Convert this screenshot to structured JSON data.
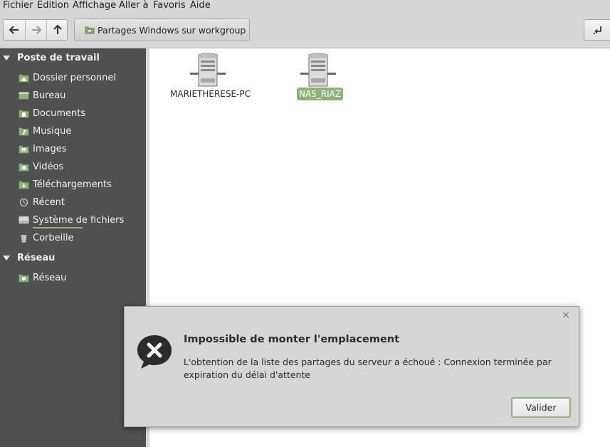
{
  "menubar": {
    "items": [
      "Fichier",
      "Édition",
      "Affichage",
      "Aller à",
      "Favoris",
      "Aide"
    ]
  },
  "toolbar": {
    "back_icon": "arrow-left-icon",
    "forward_icon": "arrow-right-icon",
    "up_icon": "arrow-up-icon",
    "location_label": "Partages Windows sur workgroup",
    "location_icon": "network-folder-icon",
    "toggle_icon": "location-entry-toggle-icon"
  },
  "sidebar": {
    "sections": [
      {
        "title": "Poste de travail",
        "items": [
          {
            "label": "Dossier personnel",
            "icon": "home-folder-icon"
          },
          {
            "label": "Bureau",
            "icon": "desktop-icon"
          },
          {
            "label": "Documents",
            "icon": "documents-folder-icon"
          },
          {
            "label": "Musique",
            "icon": "music-folder-icon"
          },
          {
            "label": "Images",
            "icon": "pictures-folder-icon"
          },
          {
            "label": "Vidéos",
            "icon": "videos-folder-icon"
          },
          {
            "label": "Téléchargements",
            "icon": "downloads-folder-icon"
          },
          {
            "label": "Récent",
            "icon": "recent-icon"
          },
          {
            "label": "Système de fichiers",
            "icon": "drive-icon"
          },
          {
            "label": "Corbeille",
            "icon": "trash-icon"
          }
        ]
      },
      {
        "title": "Réseau",
        "items": [
          {
            "label": "Réseau",
            "icon": "network-icon"
          }
        ]
      }
    ]
  },
  "files": [
    {
      "name": "MARIETHERESE-PC",
      "icon": "server-icon",
      "selected": false
    },
    {
      "name": "NAS_RIAZ",
      "icon": "server-icon",
      "selected": true
    }
  ],
  "dialog": {
    "close_label": "×",
    "icon": "error-icon",
    "title": "Impossible de monter l'emplacement",
    "message": "L'obtention de la liste des partages du serveur a échoué : Connexion terminée par expiration du délai d'attente",
    "button": "Valider"
  },
  "colors": {
    "sidebar_bg": "#505050",
    "accent": "#8fb27a",
    "window_bg": "#d6d6d6"
  }
}
